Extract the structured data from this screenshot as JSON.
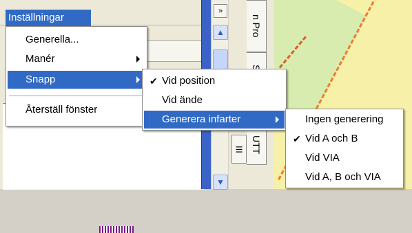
{
  "window": {
    "menu_title": "Inställningar",
    "collapse_glyph": "»",
    "scroll_up_glyph": "▲",
    "scroll_down_glyph": "▼"
  },
  "tabs": {
    "right": [
      "n Pro",
      "Sko",
      "UTT"
    ],
    "left": [
      "III"
    ]
  },
  "menu_main": {
    "items": [
      {
        "label": "Generella...",
        "submenu": false
      },
      {
        "label": "Manér",
        "submenu": true
      },
      {
        "label": "Snapp",
        "submenu": true,
        "highlighted": true
      },
      {
        "label": "Återställ fönster",
        "submenu": false
      }
    ]
  },
  "menu_snapp": {
    "items": [
      {
        "label": "Vid position",
        "checked": true
      },
      {
        "label": "Vid ände",
        "checked": false
      },
      {
        "label": "Generera infarter",
        "submenu": true,
        "highlighted": true
      }
    ]
  },
  "menu_infarter": {
    "items": [
      {
        "label": "Ingen generering",
        "checked": false
      },
      {
        "label": "Vid A och B",
        "checked": true
      },
      {
        "label": "Vid VIA",
        "checked": false
      },
      {
        "label": "Vid A, B och VIA",
        "checked": false
      }
    ]
  },
  "glyphs": {
    "check": "✔"
  },
  "colors": {
    "highlight": "#316ac5",
    "map_line": "#f07a2a",
    "map_bg": "#f6f0a8"
  }
}
